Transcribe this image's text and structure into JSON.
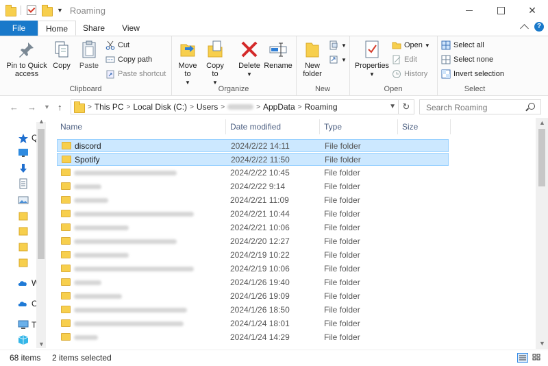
{
  "window": {
    "title": "Roaming",
    "controls": {
      "minimize": "minimize",
      "maximize": "maximize",
      "close": "✕"
    }
  },
  "ribbon_tabs": [
    "File",
    "Home",
    "Share",
    "View"
  ],
  "ribbon": {
    "clipboard": {
      "label": "Clipboard",
      "pin": "Pin to Quick access",
      "copy": "Copy",
      "paste": "Paste",
      "cut": "Cut",
      "copy_path": "Copy path",
      "paste_shortcut": "Paste shortcut"
    },
    "organize": {
      "label": "Organize",
      "move_to": "Move to",
      "copy_to": "Copy to",
      "delete": "Delete",
      "rename": "Rename"
    },
    "new": {
      "label": "New",
      "new_folder": "New folder"
    },
    "open": {
      "label": "Open",
      "properties": "Properties",
      "open": "Open",
      "edit": "Edit",
      "history": "History"
    },
    "select": {
      "label": "Select",
      "select_all": "Select all",
      "select_none": "Select none",
      "invert": "Invert selection"
    }
  },
  "address": {
    "crumbs": [
      "This PC",
      "Local Disk (C:)",
      "Users",
      "AppData",
      "Roaming"
    ],
    "search_placeholder": "Search Roaming"
  },
  "nav_pane": {
    "labels": [
      "Q",
      "W",
      "O",
      "Th"
    ]
  },
  "columns": {
    "name": "Name",
    "date": "Date modified",
    "type": "Type",
    "size": "Size"
  },
  "rows": [
    {
      "name": "discord",
      "date": "2024/2/22 14:11",
      "type": "File folder",
      "selected": true,
      "blurred": false
    },
    {
      "name": "Spotify",
      "date": "2024/2/22 11:50",
      "type": "File folder",
      "selected": true,
      "blurred": false
    },
    {
      "name": "",
      "date": "2024/2/22 10:45",
      "type": "File folder",
      "selected": false,
      "blurred": true
    },
    {
      "name": "",
      "date": "2024/2/22 9:14",
      "type": "File folder",
      "selected": false,
      "blurred": true
    },
    {
      "name": "",
      "date": "2024/2/21 11:09",
      "type": "File folder",
      "selected": false,
      "blurred": true
    },
    {
      "name": "",
      "date": "2024/2/21 10:44",
      "type": "File folder",
      "selected": false,
      "blurred": true
    },
    {
      "name": "",
      "date": "2024/2/21 10:06",
      "type": "File folder",
      "selected": false,
      "blurred": true
    },
    {
      "name": "",
      "date": "2024/2/20 12:27",
      "type": "File folder",
      "selected": false,
      "blurred": true
    },
    {
      "name": "",
      "date": "2024/2/19 10:22",
      "type": "File folder",
      "selected": false,
      "blurred": true
    },
    {
      "name": "",
      "date": "2024/2/19 10:06",
      "type": "File folder",
      "selected": false,
      "blurred": true
    },
    {
      "name": "",
      "date": "2024/1/26 19:40",
      "type": "File folder",
      "selected": false,
      "blurred": true
    },
    {
      "name": "",
      "date": "2024/1/26 19:09",
      "type": "File folder",
      "selected": false,
      "blurred": true
    },
    {
      "name": "",
      "date": "2024/1/26 18:50",
      "type": "File folder",
      "selected": false,
      "blurred": true
    },
    {
      "name": "",
      "date": "2024/1/24 18:01",
      "type": "File folder",
      "selected": false,
      "blurred": true
    },
    {
      "name": "",
      "date": "2024/1/24 14:29",
      "type": "File folder",
      "selected": false,
      "blurred": true
    }
  ],
  "status": {
    "item_count": "68 items",
    "selection": "2 items selected"
  },
  "colors": {
    "accent": "#1979ca",
    "selection_bg": "#cce8ff",
    "selection_border": "#99d1ff",
    "folder": "#f7cf4d"
  }
}
